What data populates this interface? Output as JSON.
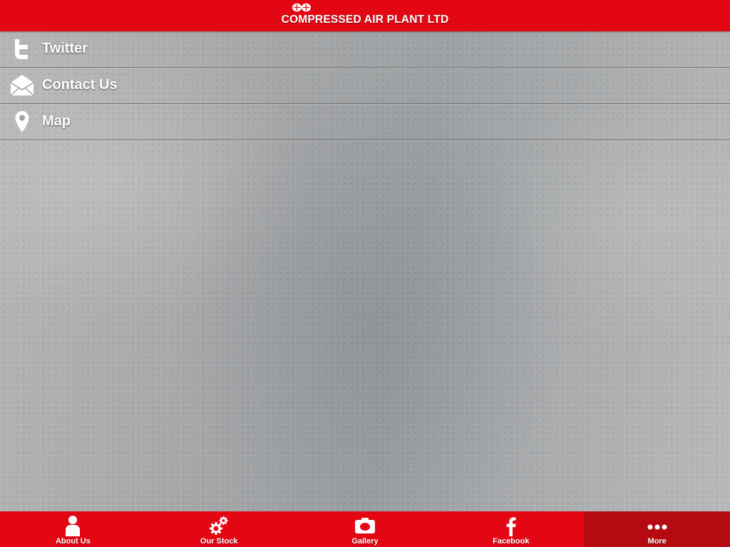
{
  "header": {
    "brand": "COMPRESSED AIR PLANT LTD"
  },
  "menu": {
    "items": [
      {
        "label": "Twitter",
        "icon": "twitter-icon"
      },
      {
        "label": "Contact Us",
        "icon": "envelope-icon"
      },
      {
        "label": "Map",
        "icon": "map-pin-icon"
      }
    ]
  },
  "tabbar": {
    "items": [
      {
        "label": "About Us",
        "icon": "person-icon"
      },
      {
        "label": "Our Stock",
        "icon": "gears-icon"
      },
      {
        "label": "Gallery",
        "icon": "camera-icon"
      },
      {
        "label": "Facebook",
        "icon": "facebook-icon"
      },
      {
        "label": "More",
        "icon": "more-dots-icon"
      }
    ],
    "active": "More"
  },
  "colors": {
    "brand_red": "#e30613",
    "active_tab": "#b50a12"
  }
}
